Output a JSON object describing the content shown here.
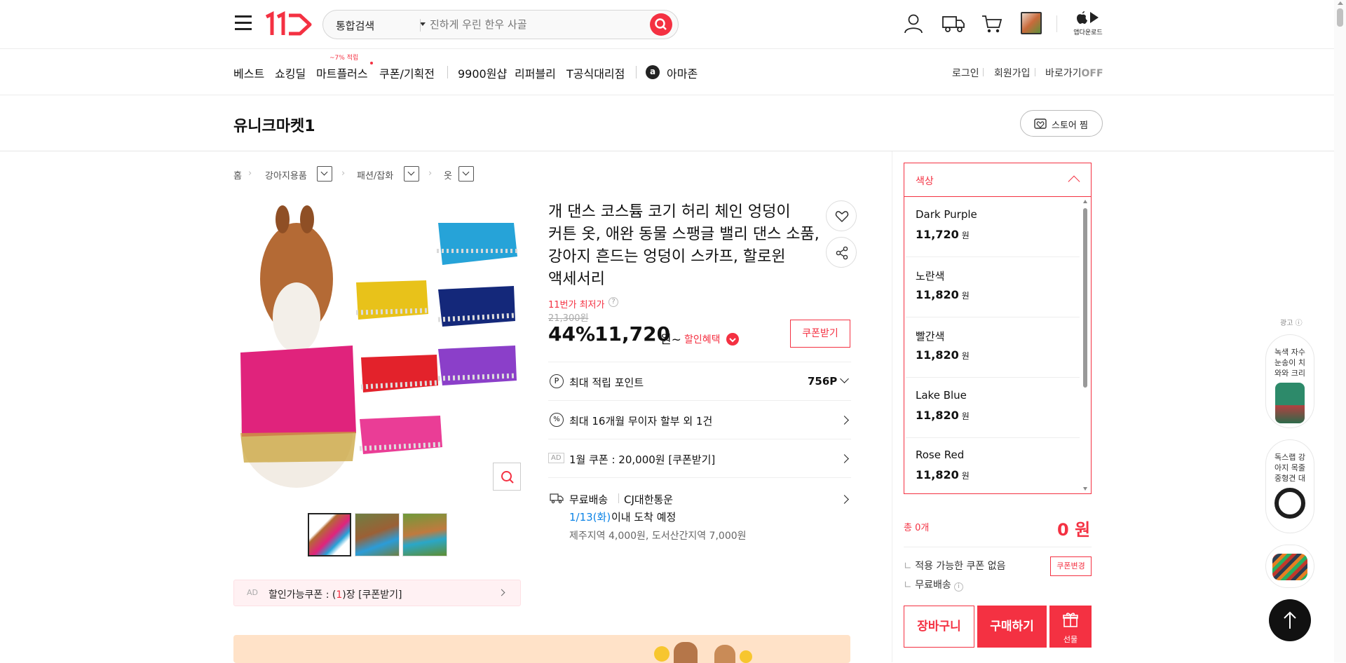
{
  "header": {
    "search_category": "통합검색",
    "search_placeholder": "진하게 우린 한우 사골",
    "app_download": "앱다운로드"
  },
  "nav": {
    "items": [
      "베스트",
      "쇼킹딜",
      "마트플러스",
      "쿠폰/기획전",
      "9900원샵",
      "리퍼블리",
      "T공식대리점",
      "아마존"
    ],
    "badge": "~7% 적립",
    "login": "로그인",
    "join": "회원가입",
    "shortcut": "바로가기",
    "shortcut_state": "OFF"
  },
  "store": {
    "name": "유니크마켓1",
    "fav_label": "스토어 찜"
  },
  "breadcrumb": [
    "홈",
    "강아지용품",
    "패션/잡화",
    "옷"
  ],
  "product": {
    "title": "개 댄스 코스튬 코기 허리 체인 엉덩이 커튼 옷, 애완 동물 스팽글 밸리 댄스 소품, 강아지 흔드는 엉덩이 스카프, 할로윈 액세서리",
    "lowest_label": "11번가 최저가",
    "original_price": "21,300원",
    "discount": "44%",
    "price": "11,720",
    "price_unit": "원~",
    "benefit": "할인혜택",
    "coupon_btn": "쿠폰받기",
    "points_label": "최대 적립 포인트",
    "points_value": "756P",
    "installment": "최대 16개월 무이자 할부 외 1건",
    "ad_coupon": "1월 쿠폰 : 20,000원 [쿠폰받기]",
    "ad_tag": "AD",
    "shipping_label": "무료배송",
    "courier": "CJ대한통운",
    "arrival_date": "1/13(화)",
    "arrival_text": "이내 도착 예정",
    "extra_fee": "제주지역 4,000원, 도서산간지역 7,000원",
    "coupon_banner_prefix": "할인가능쿠폰 : (",
    "coupon_banner_count": "1",
    "coupon_banner_suffix": ")장 [쿠폰받기]"
  },
  "options": {
    "title": "색상",
    "items": [
      {
        "name": "Dark Purple",
        "price": "11,720",
        "unit": "원"
      },
      {
        "name": "노란색",
        "price": "11,820",
        "unit": "원"
      },
      {
        "name": "빨간색",
        "price": "11,820",
        "unit": "원"
      },
      {
        "name": "Lake Blue",
        "price": "11,820",
        "unit": "원"
      },
      {
        "name": "Rose Red",
        "price": "11,820",
        "unit": "원"
      }
    ]
  },
  "order": {
    "total_label": "총 0개",
    "total_price": "0",
    "total_unit": "원",
    "coupon_none": "적용 가능한 쿠폰 없음",
    "coupon_change": "쿠폰변경",
    "free_shipping": "무료배송",
    "cart": "장바구니",
    "buy": "구매하기",
    "gift": "선물"
  },
  "ads": {
    "label": "광고",
    "items": [
      "녹색 자수 눈송이 치와와 크리",
      "독스랩 강아지 목줄 중형견 대"
    ]
  },
  "colors": {
    "brand": "#f43142",
    "blue": "#0b83e6"
  }
}
